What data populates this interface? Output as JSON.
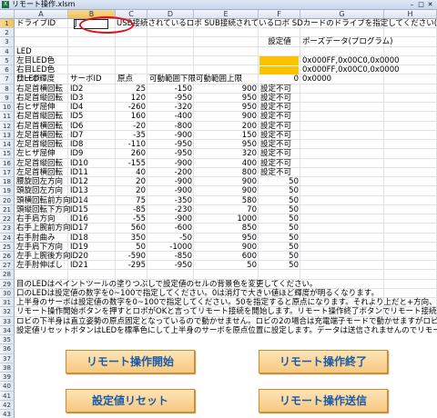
{
  "window": {
    "title": "リモート操作.xlsm",
    "app_icon": "X"
  },
  "columns": [
    "A",
    "B",
    "C",
    "D",
    "E",
    "F",
    "G",
    "H"
  ],
  "rows": [
    "1",
    "2",
    "3",
    "4",
    "5",
    "6",
    "7",
    "8",
    "9",
    "10",
    "11",
    "12",
    "13",
    "14",
    "15",
    "16",
    "17",
    "18",
    "19",
    "20",
    "21",
    "22",
    "23",
    "24",
    "25",
    "26",
    "27",
    "28",
    "29",
    "30",
    "31",
    "32",
    "33",
    "34",
    "35",
    "36",
    "37",
    "38",
    "39",
    "40",
    "41",
    "42",
    "43",
    "44"
  ],
  "drive": {
    "label": "ドライブID",
    "value": "J",
    "desc": "USB接続されているロボ  SUB接続されているロボ  SDカードのドライブを指定してください(D~Z)"
  },
  "settings_header": {
    "col_f": "設定値",
    "col_g": "ポーズデータ(プログラム)"
  },
  "led": [
    {
      "label": "LED",
      "value": "",
      "pose": ""
    },
    {
      "label": "左目LED色",
      "value": "",
      "pose": "0x000FF,0x00C0,0x0000"
    },
    {
      "label": "右目LED色",
      "value": "",
      "pose": "0x000FF,0x00C0,0x0000"
    },
    {
      "label": "口LED輝度",
      "value": "0",
      "pose": "0x0000"
    }
  ],
  "servo_header": {
    "name": "サーボ",
    "id": "サーボID",
    "origin": "原点",
    "lower": "可動範囲下限",
    "upper": "可動範囲上限"
  },
  "servos": [
    {
      "name": "右足首横回転",
      "id": "ID2",
      "origin": "25",
      "lower": "-150",
      "upper": "900",
      "value": "設定不可"
    },
    {
      "name": "右足首縦回転",
      "id": "ID3",
      "origin": "120",
      "lower": "-950",
      "upper": "950",
      "value": "設定不可"
    },
    {
      "name": "右ヒザ屈伸",
      "id": "ID4",
      "origin": "-260",
      "lower": "-320",
      "upper": "950",
      "value": "設定不可"
    },
    {
      "name": "右足首縦回転",
      "id": "ID5",
      "origin": "160",
      "lower": "-400",
      "upper": "900",
      "value": "設定不可"
    },
    {
      "name": "右足首横回転",
      "id": "ID6",
      "origin": "-20",
      "lower": "-800",
      "upper": "200",
      "value": "設定不可"
    },
    {
      "name": "左足首横回転",
      "id": "ID7",
      "origin": "-35",
      "lower": "-900",
      "upper": "150",
      "value": "設定不可"
    },
    {
      "name": "左足首縦回転",
      "id": "ID8",
      "origin": "-110",
      "lower": "-950",
      "upper": "950",
      "value": "設定不可"
    },
    {
      "name": "左ヒザ屈伸",
      "id": "ID9",
      "origin": "260",
      "lower": "-950",
      "upper": "320",
      "value": "設定不可"
    },
    {
      "name": "左足首縦回転",
      "id": "ID10",
      "origin": "-155",
      "lower": "-900",
      "upper": "400",
      "value": "設定不可"
    },
    {
      "name": "左足首横回転",
      "id": "ID11",
      "origin": "40",
      "lower": "-200",
      "upper": "800",
      "value": "設定不可"
    },
    {
      "name": "腰旋回左方向",
      "id": "ID12",
      "origin": "20",
      "lower": "-900",
      "upper": "900",
      "value": "50"
    },
    {
      "name": "頭旋回左方向",
      "id": "ID13",
      "origin": "20",
      "lower": "-900",
      "upper": "900",
      "value": "50"
    },
    {
      "name": "頭横回転前方向",
      "id": "ID14",
      "origin": "75",
      "lower": "-350",
      "upper": "580",
      "value": "50"
    },
    {
      "name": "頭縦回転下方向",
      "id": "ID15",
      "origin": "-85",
      "lower": "-230",
      "upper": "70",
      "value": "50"
    },
    {
      "name": "右手肩方向",
      "id": "ID16",
      "origin": "-55",
      "lower": "-900",
      "upper": "1000",
      "value": "50"
    },
    {
      "name": "右手上腕前方向",
      "id": "ID17",
      "origin": "560",
      "lower": "-600",
      "upper": "850",
      "value": "50"
    },
    {
      "name": "右手肘曲み",
      "id": "ID18",
      "origin": "350",
      "lower": "-50",
      "upper": "950",
      "value": "50"
    },
    {
      "name": "左手肩下方向",
      "id": "ID19",
      "origin": "50",
      "lower": "-1000",
      "upper": "900",
      "value": "50"
    },
    {
      "name": "左手上腕後方向",
      "id": "ID20",
      "origin": "-590",
      "lower": "-850",
      "upper": "600",
      "value": "50"
    },
    {
      "name": "左手肘伸ばし",
      "id": "ID21",
      "origin": "-295",
      "lower": "-950",
      "upper": "50",
      "value": "50"
    }
  ],
  "notes": [
    "目のLEDはペイントツールの塗りつぶしで設定値のセルの背景色を変更してください。",
    "口のLEDは設定値の数字を0~100で指定してください。0は消灯で大きい値ほど輝度が明るくなります。",
    "上半身のサーボは設定値の数字を0~100で指定してください。50を指定すると原点になります。それより上だと+方向、それ以下だと−方",
    "リモート操作開始ボタンを押すとロボがOKと言ってリモート接続を開始します。リモート操作終了ボタンでリモート接続が終了してアイド",
    "ロビの下半身は直立姿勢の原点固定となっているので動かせません。ロビの2の場合は充電端子モードで動かせますがロビ1の場合",
    "設定値リセットボタンはLEDを標準色にして上半身のサーボを原点位置に設定します。データは送信されませんのでリモート操作送信"
  ],
  "buttons": {
    "start": "リモート操作開始",
    "end": "リモート操作終了",
    "reset": "設定値リセット",
    "send": "リモート操作送信"
  },
  "colors": {
    "led_fill": "#ffc000",
    "button_text": "#1a5aa8",
    "highlight_circle": "#e0101a"
  }
}
